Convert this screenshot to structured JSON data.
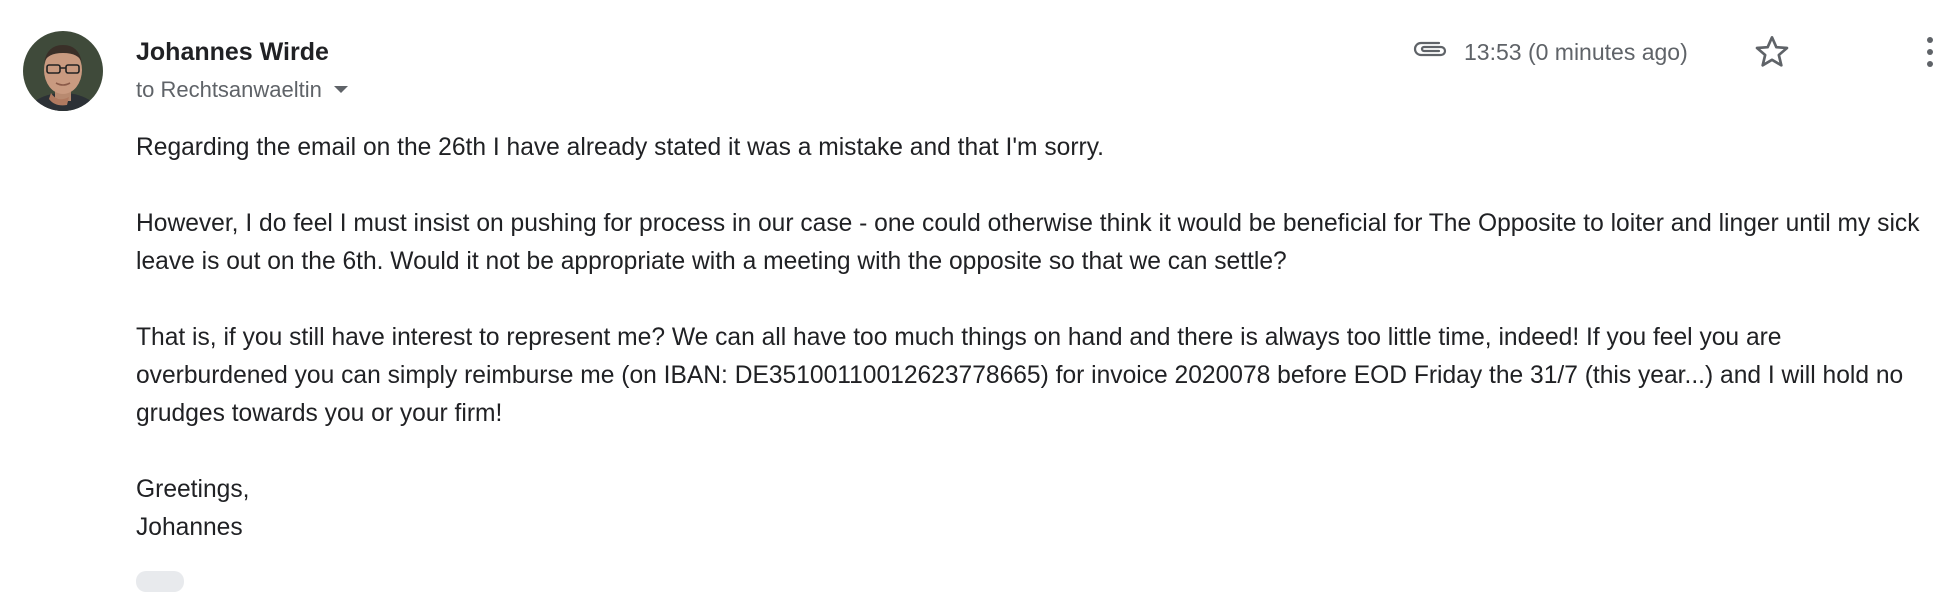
{
  "email": {
    "sender_name": "Johannes Wirde",
    "recipient": "to Rechtsanwaeltin",
    "timestamp": "13:53 (0 minutes ago)",
    "body": {
      "paragraph_1": "Regarding the email on the 26th I have already stated it was a mistake and that I'm sorry.",
      "paragraph_2": "However, I do feel I must insist on pushing for process in our case - one could otherwise think it would be beneficial for The Opposite to loiter and linger until my sick leave is out on the 6th. Would it not be appropriate with a meeting with the opposite so that we can settle?",
      "paragraph_3": "That is, if you still have interest to represent me? We can all have too much things on hand and there is always too little time, indeed! If you feel you are overburdened you can simply reimburse me (on IBAN: DE35100110012623778665) for invoice 2020078 before EOD Friday the 31/7 (this year...) and I will hold no grudges towards you or your firm!",
      "greeting": "Greetings,",
      "signature": "Johannes"
    }
  },
  "icons": {
    "attachment": "paperclip-icon",
    "star": "star-outline-icon",
    "more": "more-vert-icon",
    "recipient_dropdown": "caret-down-icon"
  },
  "colors": {
    "text_primary": "#202124",
    "text_secondary": "#5f6368",
    "trimmed_pill": "#e8eaed"
  }
}
